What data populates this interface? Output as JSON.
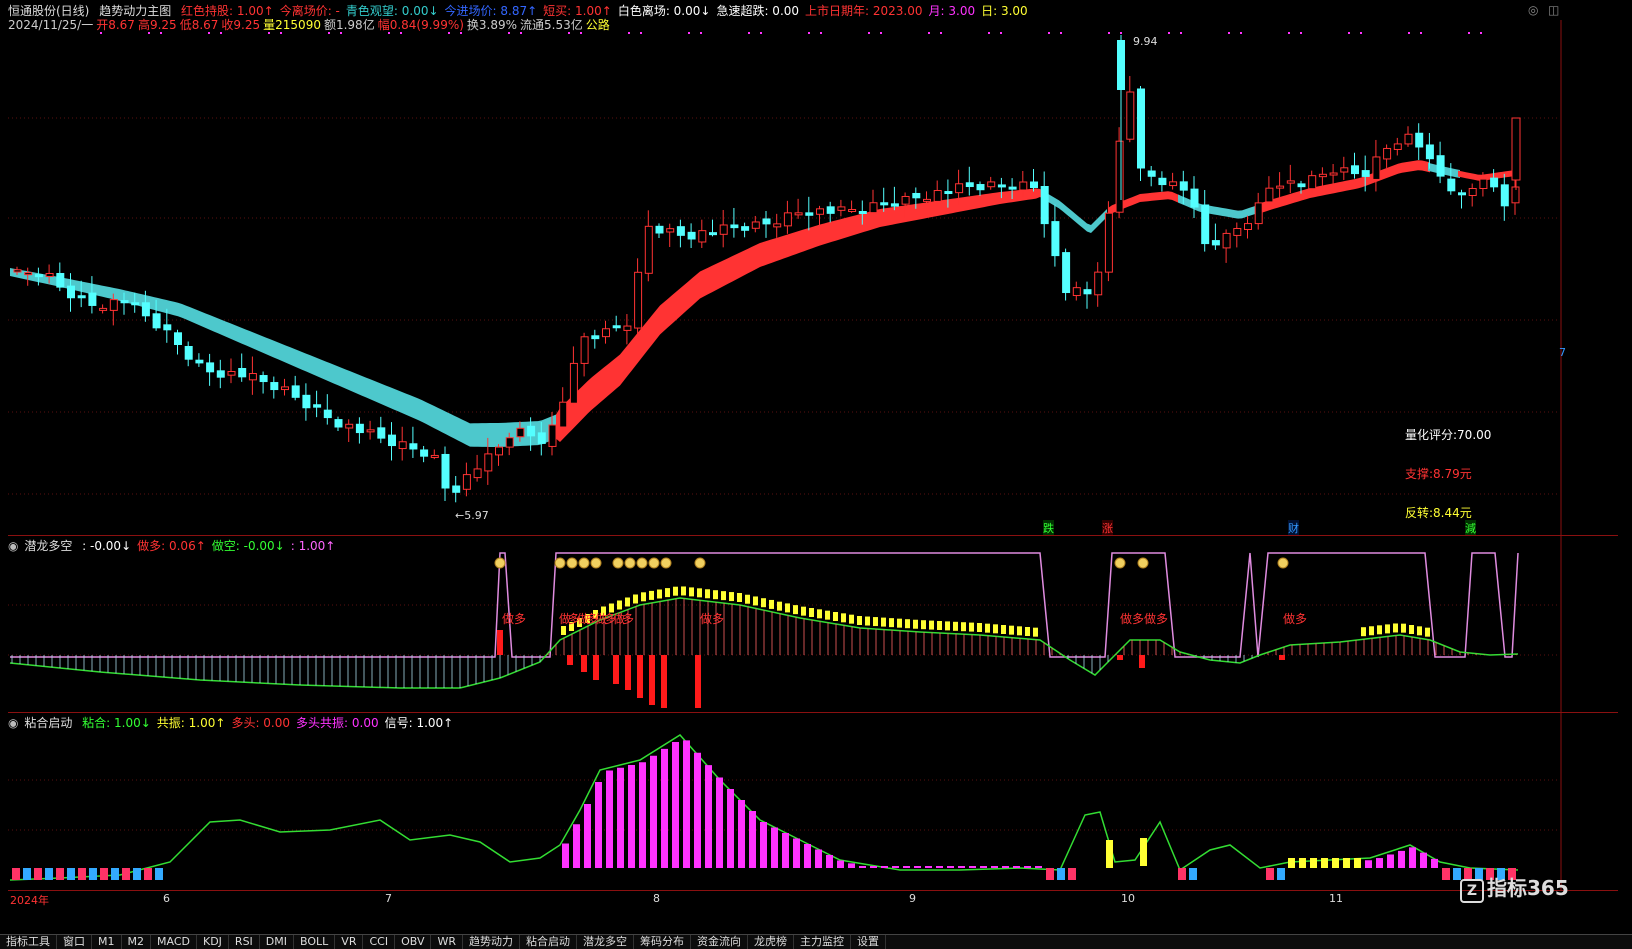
{
  "main": {
    "stock_name": "恒通股份(日线)",
    "indicator_name": "趋势动力主图",
    "ind_items": [
      {
        "label": "红色持股: 1.00↑",
        "color": "#ff3333"
      },
      {
        "label": "今离场价: -",
        "color": "#ff3333"
      },
      {
        "label": "青色观望: 0.00↓",
        "color": "#33cccc"
      },
      {
        "label": "今进场价: 8.87↑",
        "color": "#3366ff"
      },
      {
        "label": "短买: 1.00↑",
        "color": "#ff3333"
      },
      {
        "label": "白色离场: 0.00↓",
        "color": "#ffffff"
      },
      {
        "label": "急速超跌: 0.00",
        "color": "#ffffff"
      },
      {
        "label": "上市日期年: 2023.00",
        "color": "#ff3333"
      },
      {
        "label": "月: 3.00",
        "color": "#ff33ff"
      },
      {
        "label": "日: 3.00",
        "color": "#ffff33"
      }
    ],
    "quote_items": [
      {
        "label": "2024/11/25/一",
        "color": "#cccccc"
      },
      {
        "label": "开8.67",
        "color": "#ff3333"
      },
      {
        "label": "高9.25",
        "color": "#ff3333"
      },
      {
        "label": "低8.67",
        "color": "#ff3333"
      },
      {
        "label": "收9.25",
        "color": "#ff3333"
      },
      {
        "label": "量215090",
        "color": "#ffff33"
      },
      {
        "label": "额1.98亿",
        "color": "#cccccc"
      },
      {
        "label": "幅0.84(9.99%)",
        "color": "#ff3333"
      },
      {
        "label": "换3.89%",
        "color": "#cccccc"
      },
      {
        "label": "流通5.53亿",
        "color": "#cccccc"
      },
      {
        "label": "公路",
        "color": "#ffff33"
      }
    ],
    "high_label": "9.94",
    "low_label": "←5.97",
    "score_label": "量化评分:70.00",
    "support_label": "支撑:8.79元",
    "reversal_label": "反转:8.44元",
    "bottom_marks": [
      {
        "text": "跌",
        "color": "#33ff33",
        "bg": "#003300"
      },
      {
        "text": "涨",
        "color": "#ff3333",
        "bg": "#330000"
      },
      {
        "text": "财",
        "color": "#3399ff",
        "bg": "#001133"
      },
      {
        "text": "減",
        "color": "#33ff33",
        "bg": "#003300"
      }
    ],
    "right_marker": "7"
  },
  "panel2": {
    "name": "潜龙多空",
    "items": [
      {
        "label": ": -0.00↓",
        "color": "#ffffff"
      },
      {
        "label": "做多: 0.06↑",
        "color": "#ff3333"
      },
      {
        "label": "做空: -0.00↓",
        "color": "#33ff33"
      },
      {
        "label": ": 1.00↑",
        "color": "#ff66ff"
      }
    ],
    "zuoduo_label": "做多",
    "zuoduo_dense": "做多做多做多做多",
    "zuoduo_pair": "做多做多"
  },
  "panel3": {
    "name": "粘合启动",
    "items": [
      {
        "label": "粘合: 1.00↓",
        "color": "#33ff33"
      },
      {
        "label": "共振: 1.00↑",
        "color": "#ffff33"
      },
      {
        "label": "多头: 0.00",
        "color": "#ff3333"
      },
      {
        "label": "多头共振: 0.00",
        "color": "#ff33ff"
      },
      {
        "label": "信号: 1.00↑",
        "color": "#ffffff"
      }
    ]
  },
  "time_axis": [
    "2024年",
    "6",
    "7",
    "8",
    "9",
    "10",
    "11"
  ],
  "watermark": "指标365",
  "toolbar_tabs": [
    "指标工具",
    "窗口",
    "M1",
    "M2",
    "MACD",
    "KDJ",
    "RSI",
    "DMI",
    "BOLL",
    "VR",
    "CCI",
    "OBV",
    "WR",
    "趋势动力",
    "粘合启动",
    "潜龙多空",
    "筹码分布",
    "资金流向",
    "龙虎榜",
    "主力监控",
    "设置"
  ],
  "colors": {
    "up": "#ff3333",
    "down": "#54ffff",
    "band_up": "#ff3333",
    "band_down": "#4dc8cc",
    "border": "#8a1010"
  }
}
